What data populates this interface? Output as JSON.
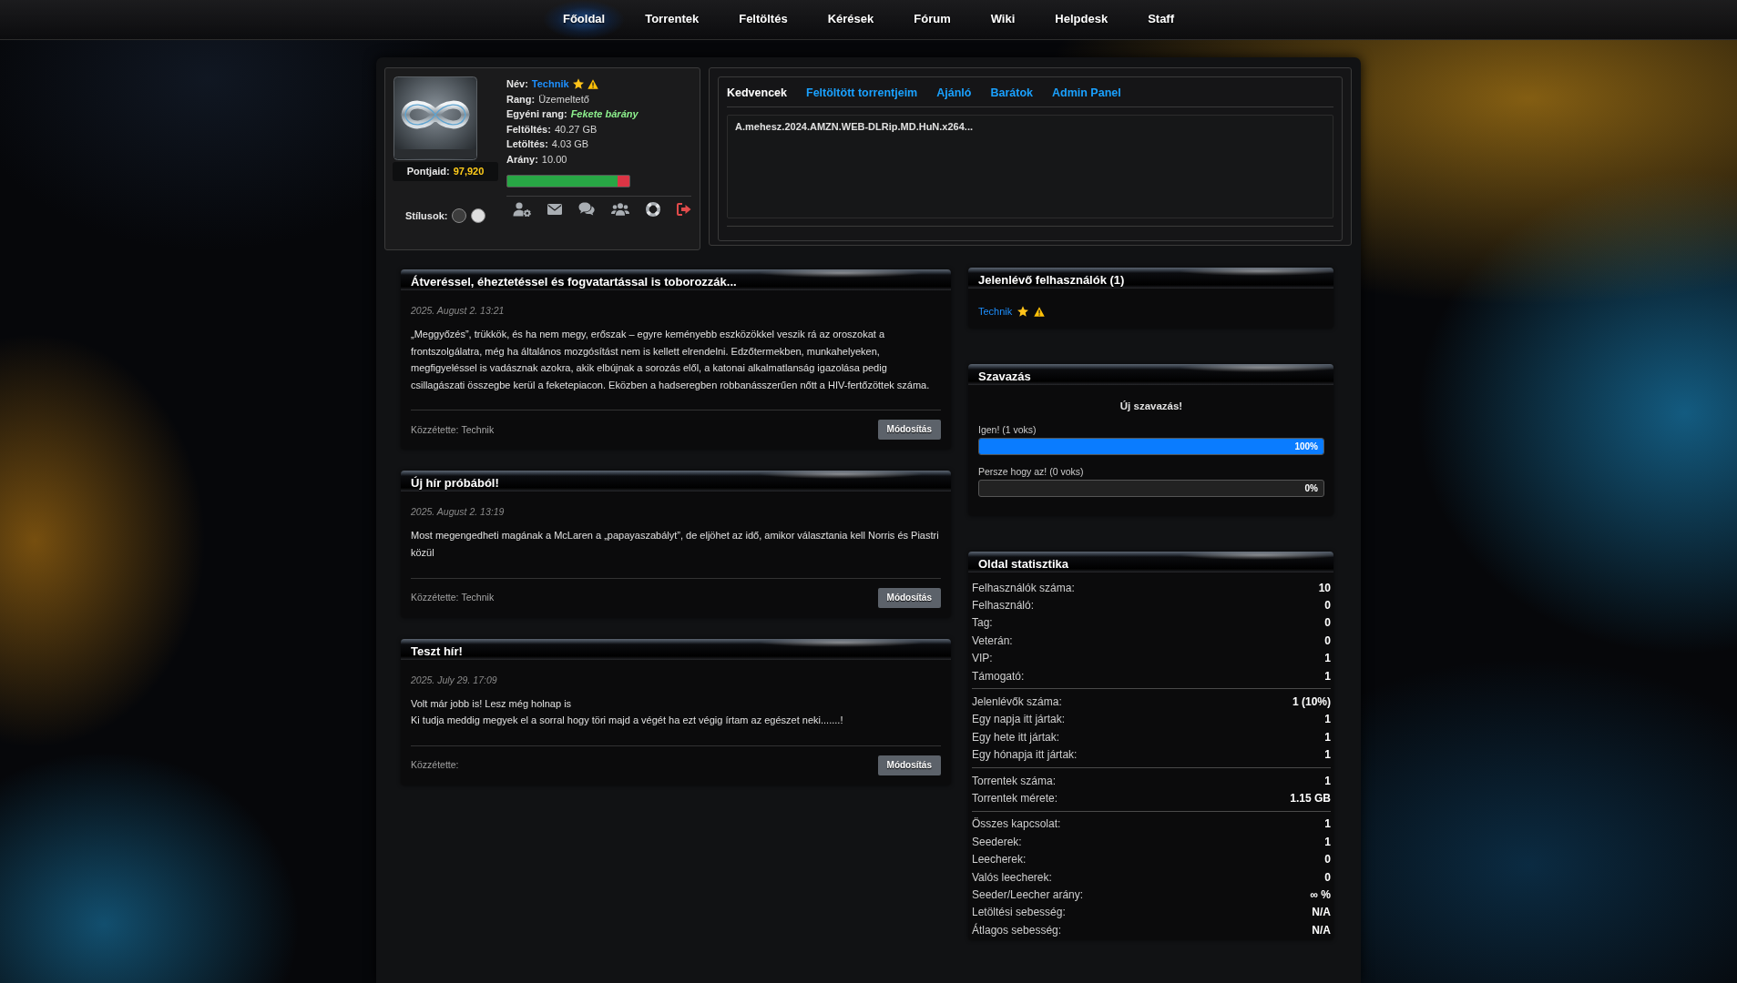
{
  "nav": [
    {
      "label": "Főoldal",
      "selected": true
    },
    {
      "label": "Torrentek",
      "selected": false
    },
    {
      "label": "Feltöltés",
      "selected": false
    },
    {
      "label": "Kérések",
      "selected": false
    },
    {
      "label": "Fórum",
      "selected": false
    },
    {
      "label": "Wiki",
      "selected": false
    },
    {
      "label": "Helpdesk",
      "selected": false
    },
    {
      "label": "Staff",
      "selected": false
    }
  ],
  "user_panel": {
    "points_label": "Pontjaid:",
    "points": "97,920",
    "styles_label": "Stílusok:",
    "styles": [
      {
        "color": "#3d3d3d"
      },
      {
        "color": "#dedede"
      }
    ],
    "fields": [
      {
        "label": "Név:",
        "value": "Technik",
        "kind": "user"
      },
      {
        "label": "Rang:",
        "value": "Üzemeltető",
        "kind": "plain"
      },
      {
        "label": "Egyéni rang:",
        "value": "Fekete bárány",
        "kind": "title"
      },
      {
        "label": "Feltöltés:",
        "value": "40.27 GB",
        "kind": "plain"
      },
      {
        "label": "Letöltés:",
        "value": "4.03 GB",
        "kind": "plain"
      },
      {
        "label": "Arány:",
        "value": "10.00",
        "kind": "plain"
      }
    ],
    "ratio": {
      "level": 0.9
    }
  },
  "profile_tabs": {
    "tabs": [
      {
        "label": "Kedvencek",
        "selected": true
      },
      {
        "label": "Feltöltött torrentjeim",
        "selected": false
      },
      {
        "label": "Ajánló",
        "selected": false
      },
      {
        "label": "Barátok",
        "selected": false
      },
      {
        "label": "Admin Panel",
        "selected": false
      }
    ],
    "items": [
      "A.mehesz.2024.AMZN.WEB-DLRip.MD.HuN.x264..."
    ]
  },
  "news": [
    {
      "title": "Átveréssel, éheztetéssel és fogvatartással is toborozzák...",
      "date": "2025. August 2. 13:21",
      "body": [
        "„Meggyőzés”, trükkök, és ha nem megy, erőszak – egyre keményebb eszközökkel veszik rá az oroszokat a frontszolgálatra, még ha általános mozgósítást nem is kellett elrendelni. Edzőtermekben, munkahelyeken, megfigyeléssel is vadásznak azokra, akik elbújnak a sorozás elől, a katonai alkalmatlanság igazolása pedig csillagászati összegbe kerül a feketepiacon. Eközben a hadseregben robbanásszerűen nőtt a HIV-fertőzöttek száma."
      ],
      "posted_by_label": "Közzétette:",
      "author": "Technik",
      "button": "Módosítás"
    },
    {
      "title": "Új hír próbából!",
      "date": "2025. August 2. 13:19",
      "body": [
        "Most megengedheti magának a McLaren a „papayaszabályt”, de eljöhet az idő, amikor választania kell Norris és Piastri közül"
      ],
      "posted_by_label": "Közzétette:",
      "author": "Technik",
      "button": "Módosítás"
    },
    {
      "title": "Teszt hír!",
      "date": "2025. July 29. 17:09",
      "body": [
        "Volt már jobb is! Lesz még holnap is",
        "Ki tudja meddig megyek el a sorral hogy töri majd a végét ha ezt végig írtam az egészet neki.......!"
      ],
      "posted_by_label": "Közzétette:",
      "button": "Módosítás"
    }
  ],
  "online_users": {
    "title": "Jelenlévő felhasználók (1)",
    "users": [
      {
        "name": "Technik"
      }
    ]
  },
  "poll": {
    "title": "Szavazás",
    "question": "Új szavazás!",
    "options": [
      {
        "label": "Igen! (1 voks)",
        "level": 1,
        "percent": "100%"
      },
      {
        "label": "Persze hogy az! (0 voks)",
        "level": 0,
        "percent": "0%"
      }
    ]
  },
  "site_stats": {
    "title": "Oldal statisztika",
    "groups": [
      {
        "rows": [
          {
            "label": "Felhasználók száma:",
            "value": "10"
          },
          {
            "label": "Felhasználó:",
            "value": "0"
          },
          {
            "label": "Tag:",
            "value": "0"
          },
          {
            "label": "Veterán:",
            "value": "0"
          },
          {
            "label": "VIP:",
            "value": "1"
          },
          {
            "label": "Támogató:",
            "value": "1"
          }
        ]
      },
      {
        "rows": [
          {
            "label": "Jelenlévők száma:",
            "value": "1 (10%)"
          },
          {
            "label": "Egy napja itt jártak:",
            "value": "1"
          },
          {
            "label": "Egy hete itt jártak:",
            "value": "1"
          },
          {
            "label": "Egy hónapja itt jártak:",
            "value": "1"
          }
        ]
      },
      {
        "rows": [
          {
            "label": "Torrentek száma:",
            "value": "1"
          },
          {
            "label": "Torrentek mérete:",
            "value": "1.15 GB"
          }
        ]
      },
      {
        "rows": [
          {
            "label": "Összes kapcsolat:",
            "value": "1"
          },
          {
            "label": "Seederek:",
            "value": "1"
          },
          {
            "label": "Leecherek:",
            "value": "0"
          },
          {
            "label": "Valós leecherek:",
            "value": "0"
          },
          {
            "label": "Seeder/Leecher arány:",
            "value": "∞ %"
          },
          {
            "label": "Letöltési sebesség:",
            "value": "N/A"
          },
          {
            "label": "Átlagos sebesség:",
            "value": "N/A"
          }
        ]
      }
    ]
  }
}
